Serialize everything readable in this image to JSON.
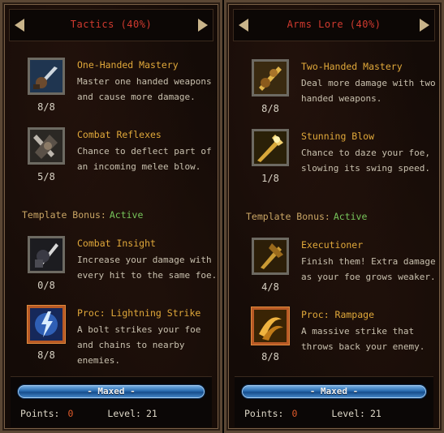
{
  "left": {
    "title": "Tactics (40%)",
    "skills_top": [
      {
        "name": "One-Handed Mastery",
        "desc": "Master one handed weapons and cause more damage.",
        "rank": "8/8",
        "icon": "fist-sword-icon"
      },
      {
        "name": "Combat Reflexes",
        "desc": "Chance to deflect part of an incoming melee blow.",
        "rank": "5/8",
        "icon": "deflect-icon"
      }
    ],
    "template_label": "Template Bonus:",
    "template_status": "Active",
    "skills_bottom": [
      {
        "name": "Combat Insight",
        "desc": "Increase your damage with every hit to the same foe.",
        "rank": "0/8",
        "icon": "insight-icon"
      },
      {
        "name": "Proc: Lightning Strike",
        "desc": "A bolt strikes your foe and chains to nearby enemies.",
        "rank": "8/8",
        "icon": "lightning-icon"
      }
    ],
    "bar_label": "- Maxed -",
    "points_label": "Points:",
    "points_value": "0",
    "level_label": "Level:",
    "level_value": "21"
  },
  "right": {
    "title": "Arms Lore (40%)",
    "skills_top": [
      {
        "name": "Two-Handed Mastery",
        "desc": "Deal more damage with two handed weapons.",
        "rank": "8/8",
        "icon": "two-hand-icon"
      },
      {
        "name": "Stunning Blow",
        "desc": "Chance to daze your foe, slowing its swing speed.",
        "rank": "1/8",
        "icon": "stun-icon"
      }
    ],
    "template_label": "Template Bonus:",
    "template_status": "Active",
    "skills_bottom": [
      {
        "name": "Executioner",
        "desc": "Finish them! Extra damage as your foe grows weaker.",
        "rank": "4/8",
        "icon": "executioner-icon"
      },
      {
        "name": "Proc: Rampage",
        "desc": "A massive strike that throws back your enemy.",
        "rank": "8/8",
        "icon": "rampage-icon"
      }
    ],
    "bar_label": "- Maxed -",
    "points_label": "Points:",
    "points_value": "0",
    "level_label": "Level:",
    "level_value": "21"
  },
  "colors": {
    "title": "#d13a2f",
    "skill_name": "#e0a83a",
    "active": "#76c45a",
    "points_value": "#e05a2a",
    "bar": "#2a6cb0"
  }
}
